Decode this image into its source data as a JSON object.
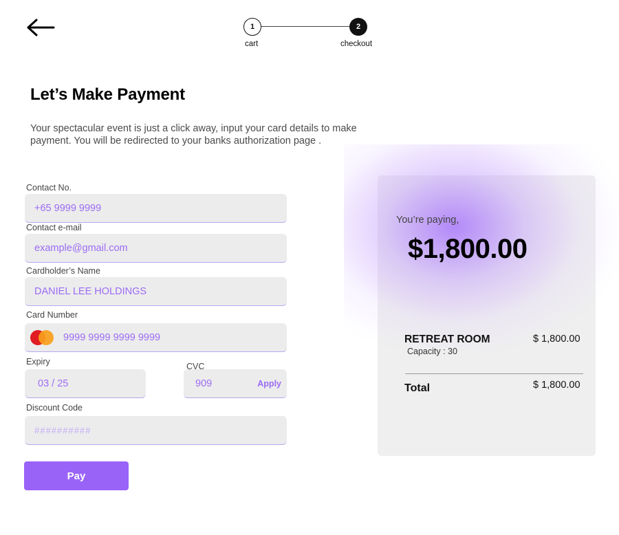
{
  "navigation": {
    "back_icon": "arrow-left-icon"
  },
  "stepper": {
    "steps": [
      {
        "number": "1",
        "label": "cart",
        "active": false
      },
      {
        "number": "2",
        "label": "checkout",
        "active": true
      }
    ]
  },
  "header": {
    "title": "Let’s Make Payment",
    "description": "Your spectacular event is just a click away, input your card details to make payment. You will be redirected to your banks authorization page ."
  },
  "form": {
    "contact_no": {
      "label": "Contact No.",
      "value": "+65 9999 9999"
    },
    "contact_email": {
      "label": "Contact e-mail",
      "value": "example@gmail.com"
    },
    "cardholder_name": {
      "label": "Cardholder’s Name",
      "value": "DANIEL LEE HOLDINGS"
    },
    "card_number": {
      "label": "Card Number",
      "value": "9999 9999 9999 9999",
      "brand_icon": "mastercard-icon"
    },
    "expiry": {
      "label": "Expiry",
      "value": "03 / 25"
    },
    "cvc": {
      "label": "CVC",
      "value": "909",
      "apply_label": "Apply"
    },
    "discount_code": {
      "label": "Discount Code",
      "placeholder": "##########"
    },
    "pay_label": "Pay"
  },
  "summary": {
    "paying_label": "You’re paying,",
    "amount": "$1,800.00",
    "item": {
      "name": "RETREAT ROOM",
      "capacity": "Capacity : 30",
      "price": "$ 1,800.00"
    },
    "total_label": "Total",
    "total_price": "$ 1,800.00"
  },
  "colors": {
    "accent": "#9a63f8",
    "input_bg": "#ececec",
    "card_bg": "#efefef",
    "input_text": "#9b6bf5"
  }
}
